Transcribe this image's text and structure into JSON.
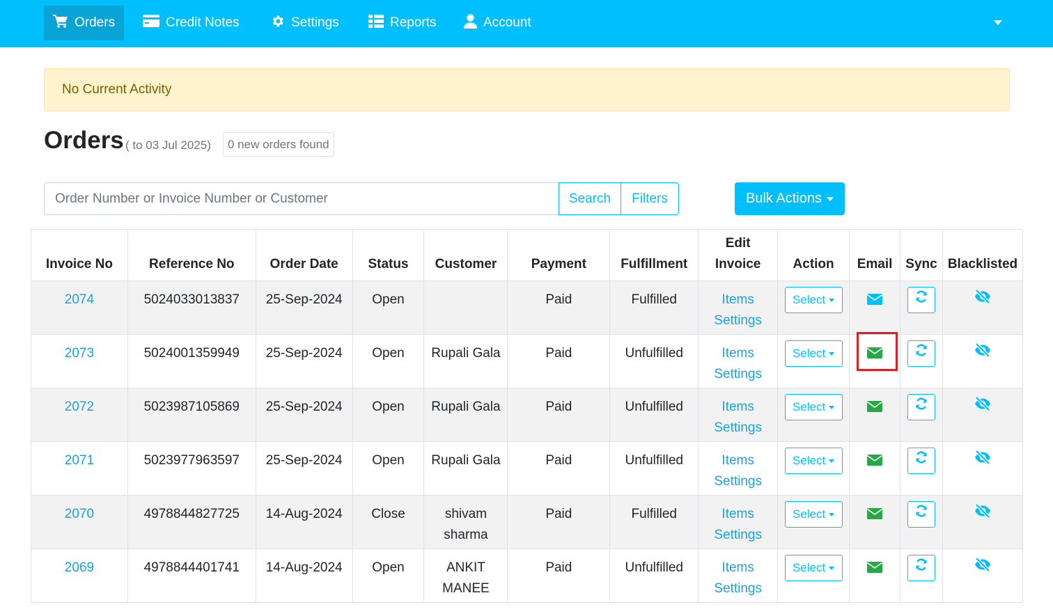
{
  "nav": {
    "items": [
      {
        "label": "Orders",
        "icon": "cart-icon"
      },
      {
        "label": "Credit Notes",
        "icon": "credit-card-icon"
      },
      {
        "label": "Settings",
        "icon": "gear-icon"
      },
      {
        "label": "Reports",
        "icon": "table-list-icon"
      },
      {
        "label": "Account",
        "icon": "user-icon"
      }
    ]
  },
  "alert": {
    "text": "No Current Activity"
  },
  "header": {
    "title": "Orders",
    "subtitle": "( to 03 Jul 2025)",
    "new_orders": "0 new orders found"
  },
  "search": {
    "placeholder": "Order Number or Invoice Number or Customer",
    "search_label": "Search",
    "filters_label": "Filters",
    "bulk_label": "Bulk Actions"
  },
  "table": {
    "columns": {
      "invoice_no": "Invoice No",
      "reference_no": "Reference No",
      "order_date": "Order Date",
      "status": "Status",
      "customer": "Customer",
      "payment": "Payment",
      "fulfillment": "Fulfillment",
      "edit_invoice_1": "Edit",
      "edit_invoice_2": "Invoice",
      "action": "Action",
      "email": "Email",
      "sync": "Sync",
      "blacklisted": "Blacklisted"
    },
    "link_items": "Items",
    "link_settings": "Settings",
    "select_label": "Select",
    "rows": [
      {
        "invoice": "2074",
        "reference": "5024033013837",
        "date": "25-Sep-2024",
        "status": "Open",
        "customer": "",
        "payment": "Paid",
        "fulfillment": "Fulfilled",
        "email_color": "#00bfff"
      },
      {
        "invoice": "2073",
        "reference": "5024001359949",
        "date": "25-Sep-2024",
        "status": "Open",
        "customer": "Rupali Gala",
        "payment": "Paid",
        "fulfillment": "Unfulfilled",
        "email_color": "#28a745"
      },
      {
        "invoice": "2072",
        "reference": "5023987105869",
        "date": "25-Sep-2024",
        "status": "Open",
        "customer": "Rupali Gala",
        "payment": "Paid",
        "fulfillment": "Unfulfilled",
        "email_color": "#28a745"
      },
      {
        "invoice": "2071",
        "reference": "5023977963597",
        "date": "25-Sep-2024",
        "status": "Open",
        "customer": "Rupali Gala",
        "payment": "Paid",
        "fulfillment": "Unfulfilled",
        "email_color": "#28a745"
      },
      {
        "invoice": "2070",
        "reference": "4978844827725",
        "date": "14-Aug-2024",
        "status": "Close",
        "customer": "shivam sharma",
        "payment": "Paid",
        "fulfillment": "Fulfilled",
        "email_color": "#28a745"
      },
      {
        "invoice": "2069",
        "reference": "4978844401741",
        "date": "14-Aug-2024",
        "status": "Open",
        "customer": "ANKIT MANEE",
        "payment": "Paid",
        "fulfillment": "Unfulfilled",
        "email_color": "#28a745"
      }
    ]
  },
  "colors": {
    "brand": "#00bfff",
    "brand_dark": "#0aa3d6",
    "link": "#1aa3e0",
    "email_sent": "#28a745",
    "highlight": "#dc1f26",
    "alert_bg": "#fff3cd"
  }
}
